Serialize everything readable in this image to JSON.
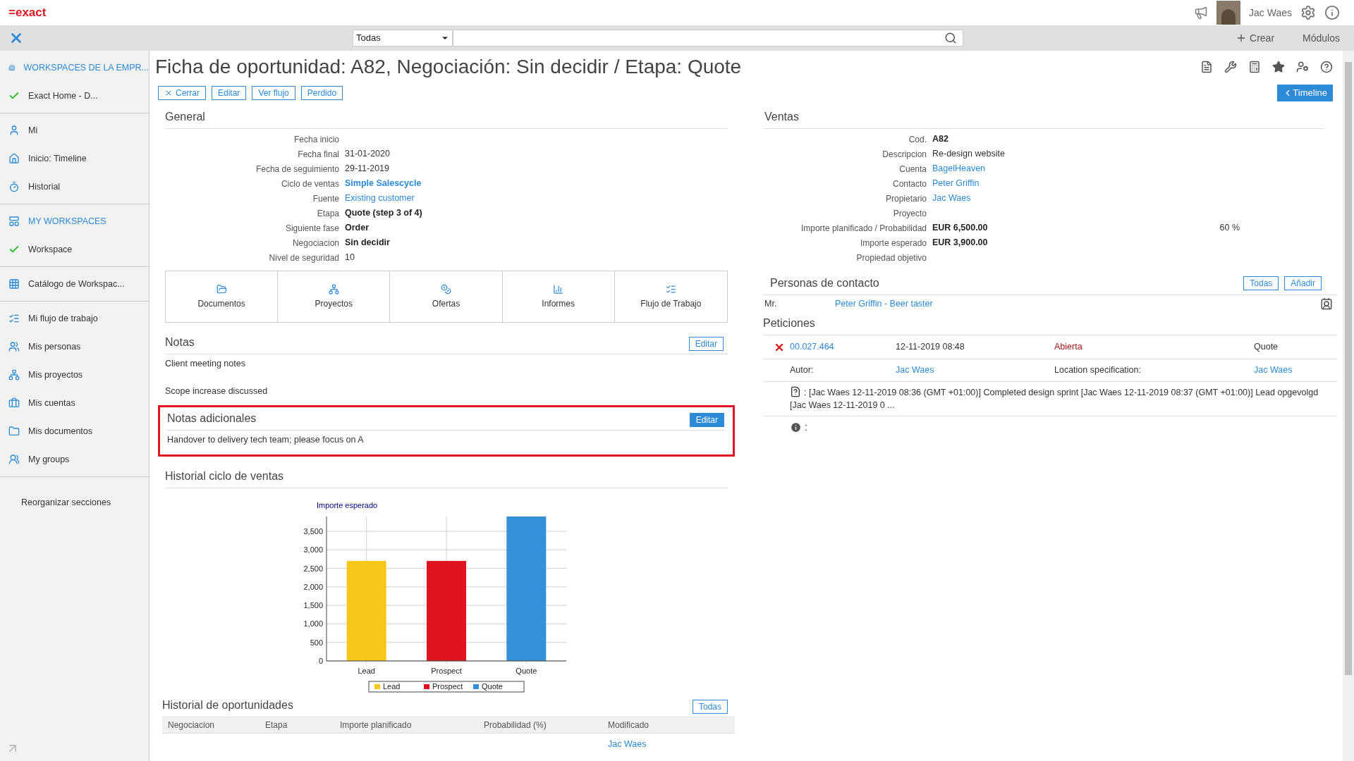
{
  "topbar": {
    "logo": "=exact",
    "user": "Jac Waes"
  },
  "toolbar": {
    "filter": "Todas",
    "create": "Crear",
    "modules": "Módulos"
  },
  "sidebar": {
    "sections": [
      [
        {
          "kind": "header",
          "label": "WORKSPACES DE LA EMPR..."
        },
        {
          "kind": "check",
          "label": "Exact Home - D..."
        }
      ],
      [
        {
          "kind": "link",
          "label": "Mi"
        },
        {
          "kind": "link",
          "label": "Inicio: Timeline"
        },
        {
          "kind": "link",
          "label": "Historial"
        }
      ],
      [
        {
          "kind": "header",
          "label": "MY WORKSPACES"
        },
        {
          "kind": "check",
          "label": "Workspace"
        }
      ],
      [
        {
          "kind": "link",
          "label": "Catálogo de Workspac..."
        }
      ],
      [
        {
          "kind": "link",
          "label": "Mi flujo de trabajo"
        },
        {
          "kind": "link",
          "label": "Mis personas"
        },
        {
          "kind": "link",
          "label": "Mis proyectos"
        },
        {
          "kind": "link",
          "label": "Mis cuentas"
        },
        {
          "kind": "link",
          "label": "Mis documentos"
        },
        {
          "kind": "link",
          "label": "My groups"
        }
      ],
      [
        {
          "kind": "plain",
          "label": "Reorganizar secciones"
        }
      ]
    ]
  },
  "page": {
    "title": "Ficha de oportunidad: A82, Negociación: Sin decidir / Etapa: Quote",
    "actions": [
      {
        "label": "Cerrar",
        "kind": "close"
      },
      {
        "label": "Editar",
        "kind": "plain"
      },
      {
        "label": "Ver flujo",
        "kind": "plain"
      },
      {
        "label": "Perdido",
        "kind": "plain"
      }
    ],
    "timeline": "Timeline"
  },
  "general": {
    "title": "General",
    "fields": [
      {
        "label": "Fecha inicio",
        "kind": "text"
      },
      {
        "label": "Fecha final",
        "value": "31-01-2020",
        "kind": "text"
      },
      {
        "label": "Fecha de seguimiento",
        "value": "29-11-2019",
        "kind": "text"
      },
      {
        "label": "Ciclo de ventas",
        "value": "Simple Salescycle",
        "kind": "boldlink"
      },
      {
        "label": "Fuente",
        "value": "Existing customer",
        "kind": "link"
      },
      {
        "label": "Etapa",
        "value": "Quote (step 3 of 4)",
        "kind": "bold"
      },
      {
        "label": "Siguiente fase",
        "value": "Order",
        "kind": "bold"
      },
      {
        "label": "Negociacion",
        "value": "Sin decidir",
        "kind": "bold"
      },
      {
        "label": "Nivel de seguridad",
        "value": "10",
        "kind": "text"
      }
    ],
    "tiles": [
      "Documentos",
      "Proyectos",
      "Ofertas",
      "Informes",
      "Flujo de Trabajo"
    ]
  },
  "notes": {
    "title": "Notas",
    "edit": "Editar",
    "lines": [
      "Client meeting notes",
      "Scope increase discussed"
    ]
  },
  "extra_notes": {
    "title": "Notas adicionales",
    "edit": "Editar",
    "text": "Handover to delivery tech team; please focus on A",
    "highlighted": true
  },
  "sales_history": {
    "title": "Historial ciclo de ventas",
    "chart_data": {
      "type": "bar",
      "title": "Importe esperado",
      "categories": [
        "Lead",
        "Prospect",
        "Quote"
      ],
      "series": [
        {
          "name": "Lead",
          "color": "#f6c719",
          "values": [
            2700,
            null,
            null
          ]
        },
        {
          "name": "Prospect",
          "color": "#e0141e",
          "values": [
            null,
            2700,
            null
          ]
        },
        {
          "name": "Quote",
          "color": "#3590da",
          "values": [
            null,
            null,
            3900
          ]
        }
      ],
      "grid": true,
      "legend": "bottom",
      "ylim": [
        0,
        3900
      ],
      "yticks": [
        {
          "value": 0,
          "label": "0"
        },
        {
          "value": 500,
          "label": "500"
        },
        {
          "value": 1000,
          "label": "1,000"
        },
        {
          "value": 1500,
          "label": "1,500"
        },
        {
          "value": 2000,
          "label": "2,000"
        },
        {
          "value": 2500,
          "label": "2,500"
        },
        {
          "value": 3000,
          "label": "3,000"
        },
        {
          "value": 3500,
          "label": "3,500"
        }
      ]
    }
  },
  "opportunity_history": {
    "title": "Historial de oportunidades",
    "all": "Todas",
    "columns": [
      "Negociacion",
      "Etapa",
      "Importe planificado",
      "Probabilidad (%)",
      "Modificado"
    ],
    "partial_cell": "Jac Waes"
  },
  "sales": {
    "title": "Ventas",
    "fields": [
      {
        "label": "Cod.",
        "value": "A82",
        "kind": "bold"
      },
      {
        "label": "Descripcion",
        "value": "Re-design website",
        "kind": "text"
      },
      {
        "label": "Cuenta",
        "value": "BagelHeaven",
        "kind": "link"
      },
      {
        "label": "Contacto",
        "value": "Peter Griffin",
        "kind": "link"
      },
      {
        "label": "Propietario",
        "value": "Jac Waes",
        "kind": "link"
      },
      {
        "label": "Proyecto",
        "kind": "text"
      },
      {
        "label": "Importe planificado / Probabilidad",
        "value": "EUR 6,500.00",
        "kind": "bold",
        "extra": "60 %"
      },
      {
        "label": "Importe esperado",
        "value": "EUR 3,900.00",
        "kind": "bold"
      },
      {
        "label": "Propiedad objetivo",
        "kind": "text"
      }
    ]
  },
  "contacts": {
    "title": "Personas de contacto",
    "buttons": [
      "Todas",
      "Añadir"
    ],
    "rows": [
      {
        "salutation": "Mr.",
        "name": "Peter Griffin - Beer taster"
      }
    ]
  },
  "requests": {
    "title": "Peticiones",
    "rows": [
      {
        "number": "00.027.464",
        "date": "12-11-2019 08:48",
        "status": "Abierta",
        "stage": "Quote",
        "author_label": "Autor:",
        "author": "Jac Waes",
        "location_label": "Location specification:",
        "location": "Jac Waes",
        "note": ": [Jac Waes 12-11-2019 08:36 (GMT +01:00)] Completed design sprint [Jac Waes 12-11-2019 08:37 (GMT +01:00)] Lead opgevolgd [Jac Waes 12-11-2019 0 ...",
        "info": ":"
      }
    ]
  }
}
